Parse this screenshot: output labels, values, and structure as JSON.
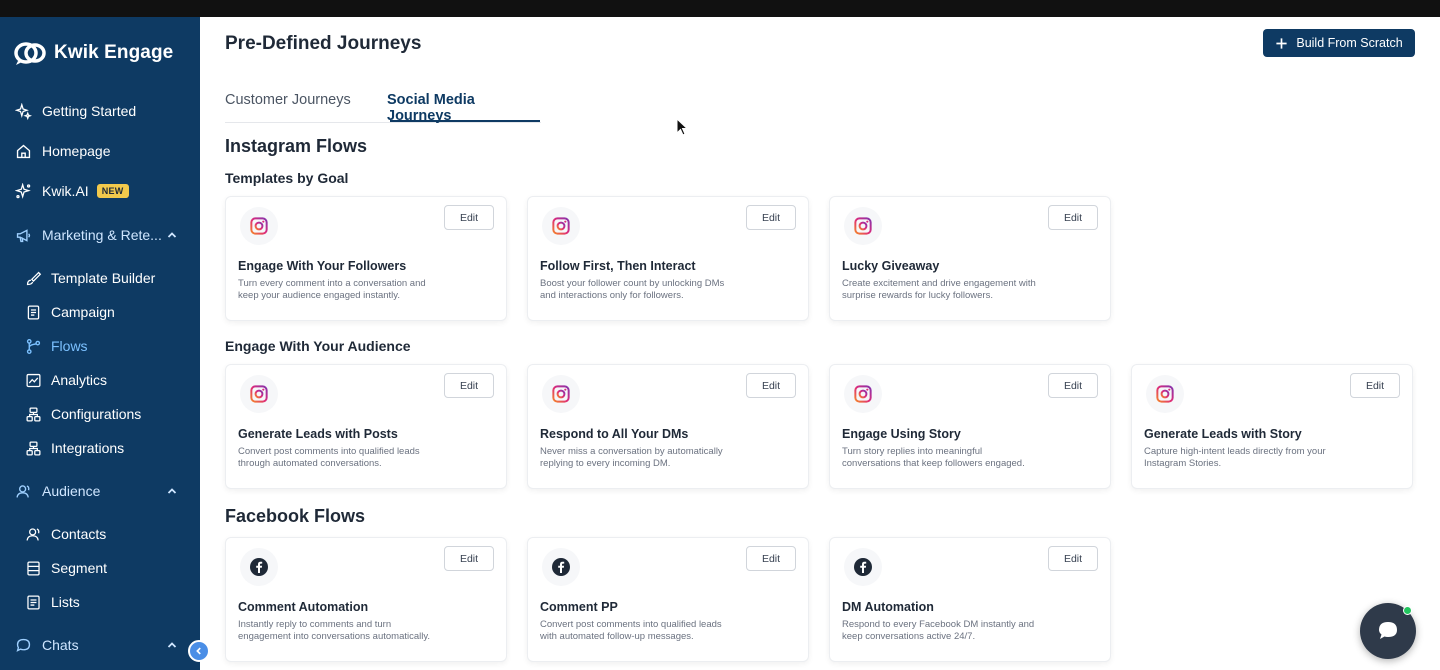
{
  "app": {
    "name": "Kwik Engage"
  },
  "colors": {
    "sidebar": "#0e3a63",
    "accent": "#0e3a63",
    "active_link": "#7cc1ff",
    "badge": "#f2c94c"
  },
  "sidebar": {
    "items": [
      {
        "label": "Getting Started",
        "icon": "sparkle-icon"
      },
      {
        "label": "Homepage",
        "icon": "home-icon"
      },
      {
        "label": "Kwik.AI",
        "icon": "ai-sparkle-icon",
        "badge": "NEW"
      },
      {
        "label": "Marketing & Rete...",
        "icon": "megaphone-icon",
        "expanded": true
      },
      {
        "label": "Template Builder",
        "icon": "brush-icon"
      },
      {
        "label": "Campaign",
        "icon": "document-icon"
      },
      {
        "label": "Flows",
        "icon": "flow-icon",
        "active": true
      },
      {
        "label": "Analytics",
        "icon": "chart-icon"
      },
      {
        "label": "Configurations",
        "icon": "config-icon"
      },
      {
        "label": "Integrations",
        "icon": "integrations-icon"
      },
      {
        "label": "Audience",
        "icon": "audience-icon",
        "expanded": true
      },
      {
        "label": "Contacts",
        "icon": "contacts-icon"
      },
      {
        "label": "Segment",
        "icon": "segment-icon"
      },
      {
        "label": "Lists",
        "icon": "list-icon"
      },
      {
        "label": "Chats",
        "icon": "chat-icon",
        "expanded": true
      }
    ]
  },
  "header": {
    "title": "Pre-Defined Journeys",
    "build_button": "Build From Scratch"
  },
  "tabs": [
    {
      "label": "Customer Journeys",
      "active": false
    },
    {
      "label": "Social Media Journeys",
      "active": true
    }
  ],
  "sections": {
    "instagram": {
      "title": "Instagram Flows",
      "groups": [
        {
          "title": "Templates by Goal",
          "cards": [
            {
              "title": "Engage With Your Followers",
              "desc": "Turn every comment into a conversation and keep your audience engaged instantly.",
              "edit": "Edit",
              "icon": "instagram-icon"
            },
            {
              "title": "Follow First, Then Interact",
              "desc": "Boost your follower count by unlocking DMs and interactions only for followers.",
              "edit": "Edit",
              "icon": "instagram-icon"
            },
            {
              "title": "Lucky Giveaway",
              "desc": "Create excitement and drive engagement with surprise rewards for lucky followers.",
              "edit": "Edit",
              "icon": "instagram-icon"
            }
          ]
        },
        {
          "title": "Engage With Your Audience",
          "cards": [
            {
              "title": "Generate Leads with Posts",
              "desc": "Convert post comments into qualified leads through automated conversations.",
              "edit": "Edit",
              "icon": "instagram-icon"
            },
            {
              "title": "Respond to All Your DMs",
              "desc": "Never miss a conversation by automatically replying to every incoming DM.",
              "edit": "Edit",
              "icon": "instagram-icon"
            },
            {
              "title": "Engage Using Story",
              "desc": "Turn story replies into meaningful conversations that keep followers engaged.",
              "edit": "Edit",
              "icon": "instagram-icon"
            },
            {
              "title": "Generate Leads with Story",
              "desc": "Capture high-intent leads directly from your Instagram Stories.",
              "edit": "Edit",
              "icon": "instagram-icon"
            }
          ]
        }
      ]
    },
    "facebook": {
      "title": "Facebook Flows",
      "cards": [
        {
          "title": "Comment Automation",
          "desc": "Instantly reply to comments and turn engagement into conversations automatically.",
          "edit": "Edit",
          "icon": "facebook-icon"
        },
        {
          "title": "Comment PP",
          "desc": "Convert post comments into qualified leads with automated follow-up messages.",
          "edit": "Edit",
          "icon": "facebook-icon"
        },
        {
          "title": "DM Automation",
          "desc": "Respond to every Facebook DM instantly and keep conversations active 24/7.",
          "edit": "Edit",
          "icon": "facebook-icon"
        }
      ]
    }
  }
}
